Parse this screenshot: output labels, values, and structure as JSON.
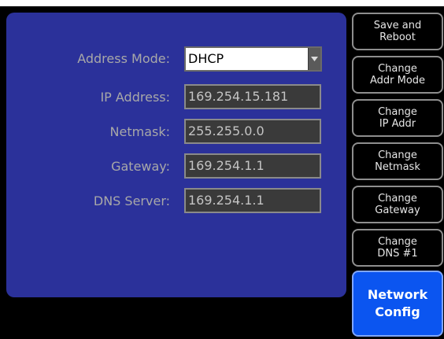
{
  "form": {
    "address_mode": {
      "label": "Address Mode:",
      "value": "DHCP"
    },
    "ip_address": {
      "label": "IP Address:",
      "value": "169.254.15.181"
    },
    "netmask": {
      "label": "Netmask:",
      "value": "255.255.0.0"
    },
    "gateway": {
      "label": "Gateway:",
      "value": "169.254.1.1"
    },
    "dns_server": {
      "label": "DNS Server:",
      "value": "169.254.1.1"
    }
  },
  "sidebar": {
    "buttons": [
      {
        "line1": "Save and",
        "line2": "Reboot"
      },
      {
        "line1": "Change",
        "line2": "Addr Mode"
      },
      {
        "line1": "Change",
        "line2": "IP Addr"
      },
      {
        "line1": "Change",
        "line2": "Netmask"
      },
      {
        "line1": "Change",
        "line2": "Gateway"
      },
      {
        "line1": "Change",
        "line2": "DNS #1"
      }
    ],
    "active": {
      "line1": "Network",
      "line2": "Config"
    }
  },
  "colors": {
    "panel": "#2b319a",
    "active_button": "#0b55f0",
    "background": "#000000"
  },
  "icons": {
    "dropdown": "chevron-down-icon"
  }
}
